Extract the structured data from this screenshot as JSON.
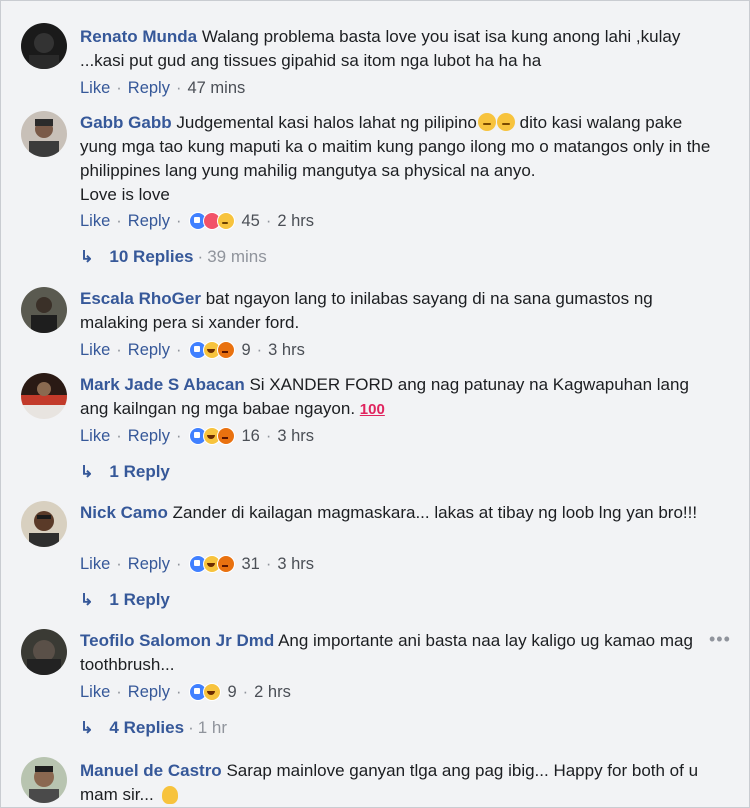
{
  "actions": {
    "like": "Like",
    "reply": "Reply",
    "sep": "·"
  },
  "comments": [
    {
      "author": "Renato Munda",
      "text": "Walang problema basta love you isat isa kung anong lahi ,kulay ...kasi put gud ang tissues gipahid sa itom nga lubot ha ha ha",
      "time": "47 mins"
    },
    {
      "author": "Gabb Gabb",
      "text": "Judgemental kasi halos lahat ng pilipino",
      "text2": " dito kasi walang pake yung mga tao kung maputi ka o maitim kung pango ilong mo o matangos only in the philippines lang yung mahilig mangutya sa physical na anyo.",
      "text3": "Love is love",
      "count": "45",
      "time": "2 hrs",
      "replies": "10 Replies",
      "replies_time": "39 mins"
    },
    {
      "author": "Escala RhoGer",
      "text": "bat ngayon lang to inilabas sayang di na sana gumastos ng malaking pera si xander ford.",
      "count": "9",
      "time": "3 hrs"
    },
    {
      "author": "Mark Jade S Abacan",
      "text": "Si XANDER FORD ang nag patunay na Kagwapuhan lang ang kailngan ng mga babae ngayon.",
      "emoji": "100",
      "count": "16",
      "time": "3 hrs",
      "replies": "1 Reply"
    },
    {
      "author": "Nick Camo",
      "text": "Zander di kailagan magmaskara... lakas at tibay ng loob lng yan bro!!!",
      "count": "31",
      "time": "3 hrs",
      "replies": "1 Reply"
    },
    {
      "author": "Teofilo Salomon Jr Dmd",
      "text": "Ang importante ani basta naa lay kaligo ug kamao mag toothbrush...",
      "count": "9",
      "time": "2 hrs",
      "replies": "4 Replies",
      "replies_time": "1 hr"
    },
    {
      "author": "Manuel de Castro",
      "text": "Sarap mainlove ganyan tlga ang pag ibig... Happy for both of u mam sir..."
    }
  ],
  "more_label": "•••",
  "colors": {
    "link": "#365899",
    "meta": "#4b4f56",
    "muted": "#90949c",
    "bg": "#f2f3f5"
  }
}
